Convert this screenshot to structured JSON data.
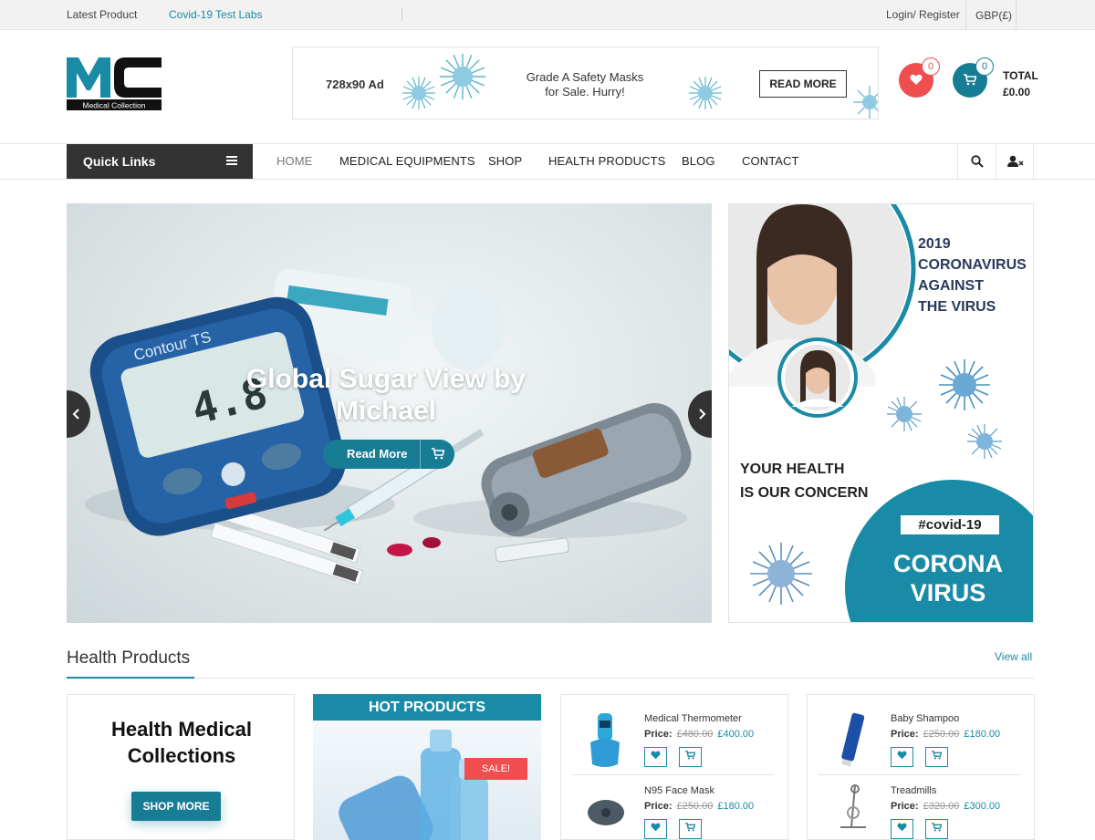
{
  "topbar": {
    "latest": "Latest Product",
    "ticker": "Covid-19 Test Labs",
    "login": "Login/ Register",
    "currency": "GBP(£)"
  },
  "logo": {
    "letters": "MC",
    "tagline": "Medical Collection"
  },
  "ad": {
    "size": "728x90 Ad",
    "text_line1": "Grade A Safety Masks",
    "text_line2": "for Sale. Hurry!",
    "button": "READ MORE"
  },
  "header": {
    "wishlist_count": "0",
    "cart_count": "0",
    "total_label": "TOTAL",
    "total_value": "£0.00"
  },
  "nav": {
    "quick_links": "Quick Links",
    "items": [
      "HOME",
      "MEDICAL EQUIPMENTS",
      "SHOP",
      "HEALTH PRODUCTS",
      "BLOG",
      "CONTACT"
    ]
  },
  "slider": {
    "title_line1": "Global Sugar View by",
    "title_line2": "Michael",
    "button": "Read More",
    "device_label": "Contour TS",
    "device_reading": "4.8"
  },
  "side_banner": {
    "year": "2019",
    "line1": "CORONAVIRUS",
    "line2": "AGAINST",
    "line3": "THE VIRUS",
    "concern1": "YOUR HEALTH",
    "concern2": "IS OUR CONCERN",
    "hashtag": "#covid-19",
    "big1": "CORONA",
    "big2": "VIRUS"
  },
  "section": {
    "title": "Health Products",
    "view_all": "View all"
  },
  "promo": {
    "line1": "Health Medical",
    "line2": "Collections",
    "button": "SHOP MORE"
  },
  "hot": {
    "title": "HOT PRODUCTS",
    "sale": "SALE!"
  },
  "products_a": [
    {
      "name": "Medical Thermometer",
      "price_label": "Price:",
      "old": "£480.00",
      "new": "£400.00"
    },
    {
      "name": "N95 Face Mask",
      "price_label": "Price:",
      "old": "£250.00",
      "new": "£180.00"
    }
  ],
  "products_b": [
    {
      "name": "Baby Shampoo",
      "price_label": "Price:",
      "old": "£250.00",
      "new": "£180.00"
    },
    {
      "name": "Treadmills",
      "price_label": "Price:",
      "old": "£320.00",
      "new": "£300.00"
    }
  ],
  "colors": {
    "accent": "#1a8ba6",
    "dark_teal": "#177d94",
    "wishlist": "#ee4e4e",
    "nav_dark": "#333333"
  },
  "icons": [
    "heart-icon",
    "cart-icon",
    "search-icon",
    "user-icon",
    "hamburger-icon",
    "chevron-left-icon",
    "chevron-right-icon"
  ]
}
